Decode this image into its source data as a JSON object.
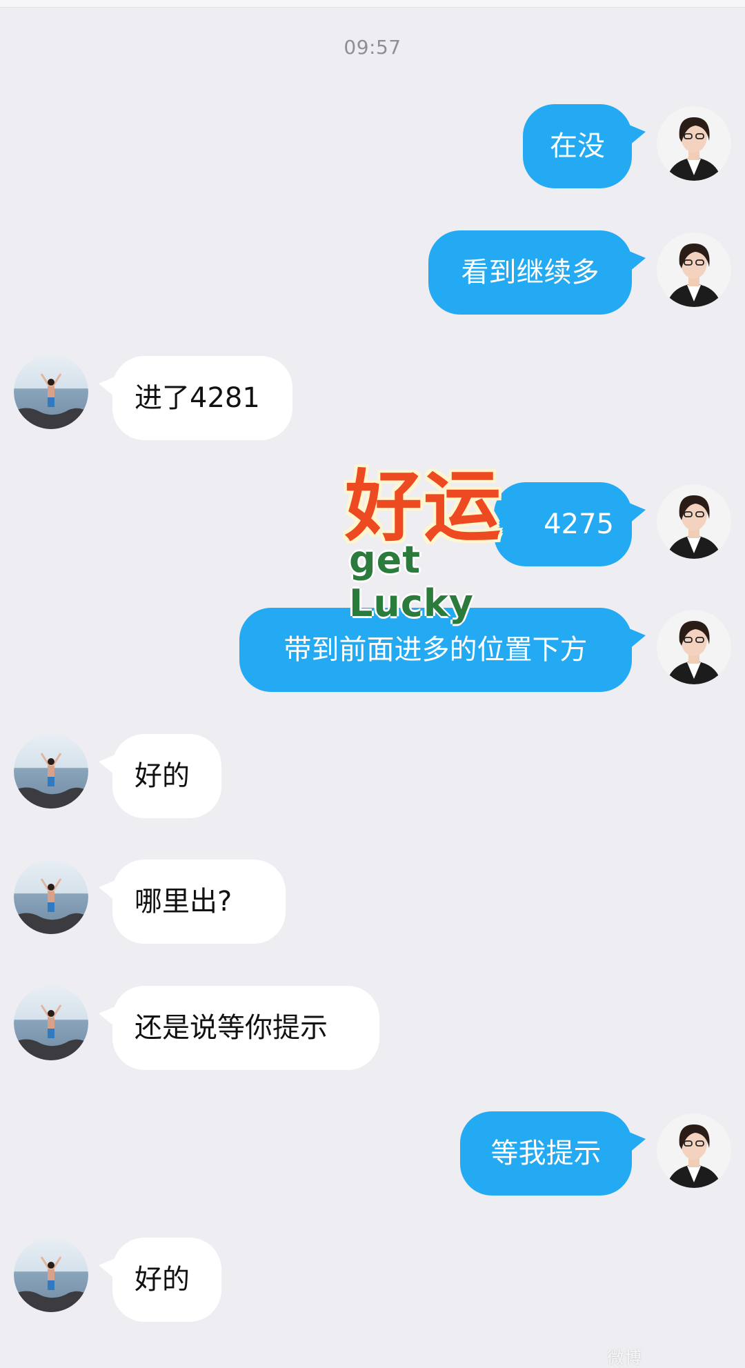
{
  "chat": {
    "timestamp": "09:57",
    "colors": {
      "background": "#ededf2",
      "outgoing_bubble": "#23aaf2",
      "incoming_bubble": "#ffffff"
    },
    "messages": [
      {
        "direction": "outgoing",
        "text": "在没"
      },
      {
        "direction": "outgoing",
        "text": "看到继续多"
      },
      {
        "direction": "incoming",
        "text": "进了4281"
      },
      {
        "direction": "outgoing",
        "text": "4275"
      },
      {
        "direction": "outgoing",
        "text": "带到前面进多的位置下方"
      },
      {
        "direction": "incoming",
        "text": "好的"
      },
      {
        "direction": "incoming",
        "text": "哪里出?"
      },
      {
        "direction": "incoming",
        "text": "还是说等你提示"
      },
      {
        "direction": "outgoing",
        "text": "等我提示"
      },
      {
        "direction": "incoming",
        "text": "好的"
      }
    ],
    "sticker": {
      "main_text": "好运",
      "sub_text": "get Lucky"
    },
    "watermark": "微博"
  }
}
